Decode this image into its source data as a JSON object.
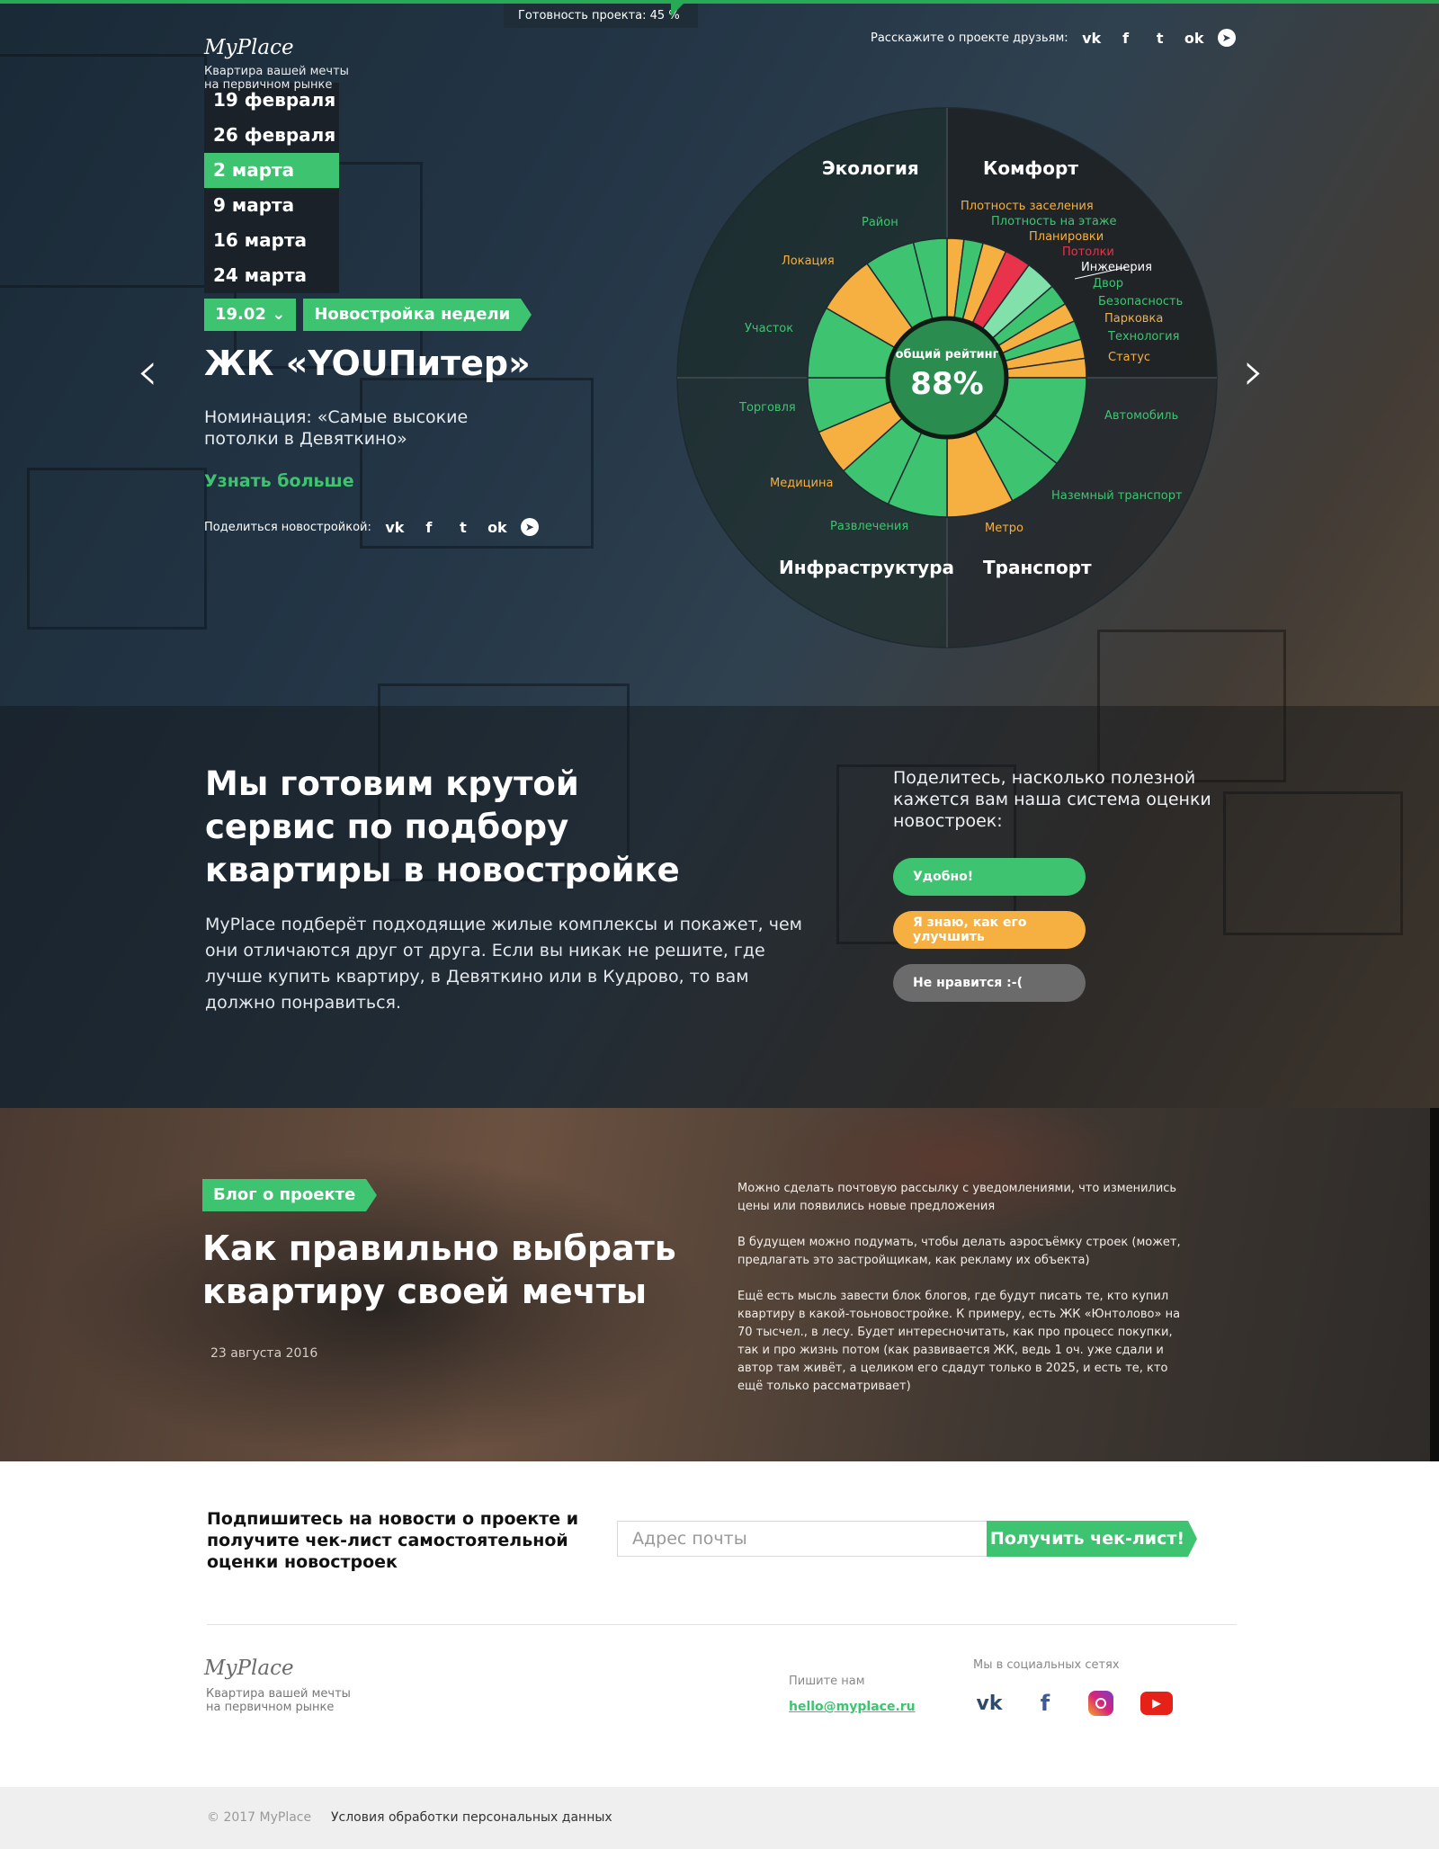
{
  "header": {
    "progress_label": "Готовность проекта: 45 %",
    "progress_value": 0.45,
    "logo": "MyPlace",
    "tagline": "Квартира вашей мечты на первичном рынке",
    "share_label": "Расскажите о проекте друзьям:",
    "social_icons": [
      "vk-icon",
      "facebook-icon",
      "twitter-icon",
      "odnoklassniki-icon",
      "telegram-icon"
    ]
  },
  "dates": {
    "items": [
      "19 февраля",
      "26 февраля",
      "2 марта",
      "9 марта",
      "16 марта",
      "24 марта"
    ],
    "active_index": 2
  },
  "newbuild": {
    "date_selector": "19.02",
    "badge": "Новостройка недели",
    "title": "ЖК «YOUПитер»",
    "nomination": "Номинация: «Самые высокие потолки в Девяткино»",
    "more_link": "Узнать больше",
    "share_label": "Поделиться новостройкой:"
  },
  "chart_data": {
    "type": "pie",
    "title": "общий рейтинг",
    "center_value": "88%",
    "categories": [
      "Экология",
      "Комфорт",
      "Транспорт",
      "Инфраструктура"
    ],
    "labels": [
      "Район",
      "Локация",
      "Участок",
      "Торговля",
      "Медицина",
      "Развлечения",
      "Метро",
      "Наземный транспорт",
      "Автомобиль",
      "Статус",
      "Технология",
      "Парковка",
      "Безопасность",
      "Двор",
      "Инженерия",
      "Потолки",
      "Планировки",
      "Плотность на этаже",
      "Плотность заселения"
    ]
  },
  "service": {
    "title": "Мы готовим крутой сервис по подбору квартиры в новостройке",
    "description": "MyPlace подберёт подходящие жилые комплексы и покажет, чем они отличаются друг от друга. Если вы никак не решите, где лучше купить квартиру, в Девяткино или в Кудрово, то вам должно понравиться.",
    "question": "Поделитесь, насколько полезной кажется вам наша система оценки новостроек:",
    "btn_good": "Удобно!",
    "btn_improve": "Я знаю, как его улучшить",
    "btn_bad": "Не нравится :-("
  },
  "blog": {
    "tag": "Блог о проекте",
    "title": "Как правильно выбрать квартиру своей мечты",
    "date": "23 августа 2016",
    "p1": "Можно сделать почтовую рассылку с уведомлениями, что изменились цены или появились новые предложения",
    "p2": "В будущем можно подумать, чтобы делать аэросъёмку строек (может, предлагать это застройщикам, как рекламу их объекта)",
    "p3": "Ещё есть мысль завести блок блогов, где будут писать те, кто купил квартиру в какой-тоьновостройке. К примеру, есть ЖК «Юнтолово» на 70 тысчел., в лесу. Будет интересночитать, как про процесс покупки, так и про жизнь потом (как развивается ЖК, ведь 1 оч. уже сдали и автор там живёт, а целиком его сдадут только в 2025, и есть те, кто ещё только рассматривает)"
  },
  "subscribe": {
    "text": "Подпишитесь на новости о проекте и получите чек-лист самостоятельной оценки новостроек",
    "placeholder": "Адрес почты",
    "button": "Получить чек-лист!"
  },
  "footer": {
    "logo": "MyPlace",
    "tagline": "Квартира вашей мечты на первичном рынке",
    "write_label": "Пишите нам",
    "email": "hello@myplace.ru",
    "social_label": "Мы в социальных сетях",
    "social_icons": [
      "vk-icon",
      "facebook-icon",
      "instagram-icon",
      "youtube-icon"
    ],
    "copyright": "© 2017 MyPlace",
    "terms": "Условия обработки персональных данных"
  },
  "colors": {
    "green": "#3ec471",
    "orange": "#f5b041",
    "red": "#e8334a",
    "mint": "#82e0aa",
    "dark_green": "#2a8c4e"
  }
}
